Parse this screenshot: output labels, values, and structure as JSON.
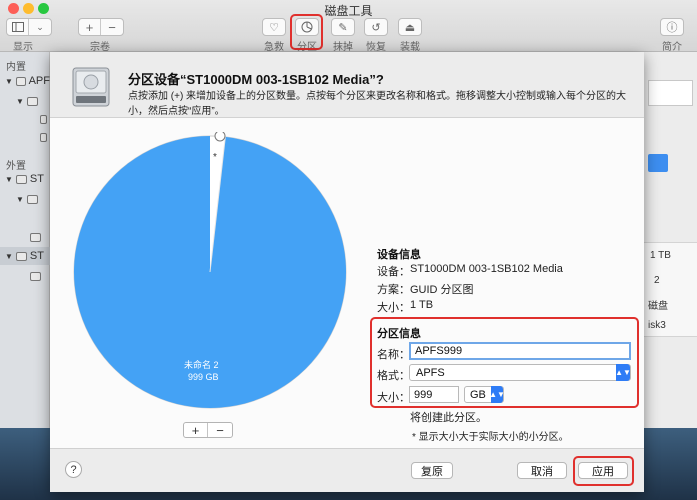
{
  "window": {
    "title": "磁盘工具",
    "toolbar": {
      "show_label": "显示",
      "volume_label": "宗卷",
      "firstaid_label": "急救",
      "partition_label": "分区",
      "erase_label": "抹掉",
      "restore_label": "恢复",
      "mount_label": "装载",
      "info_label": "简介",
      "add_glyph": "+",
      "remove_glyph": "−"
    }
  },
  "sidebar": {
    "internal_header": "内置",
    "external_header": "外置",
    "items": [
      {
        "label": "APF"
      },
      {
        "label": "ST"
      },
      {
        "label": "ST"
      }
    ]
  },
  "right_panel": {
    "cells": [
      "1 TB",
      "2",
      "磁盘",
      "isk3"
    ]
  },
  "sheet": {
    "title": "分区设备“ST1000DM 003-1SB102 Media”?",
    "description": "点按添加 (+) 来增加设备上的分区数量。点按每个分区来更改名称和格式。拖移调整大小控制或输入每个分区的大小，然后点按“应用”。",
    "pie": {
      "segment_label": "未命名 2",
      "segment_size": "999 GB",
      "small_mark": "*",
      "fraction": 0.999
    },
    "stepper": {
      "add": "+",
      "remove": "−"
    },
    "device_info": {
      "heading": "设备信息",
      "device_label": "设备：",
      "device_value": "ST1000DM 003-1SB102 Media",
      "scheme_label": "方案：",
      "scheme_value": "GUID 分区图",
      "size_label": "大小：",
      "size_value": "1 TB"
    },
    "partition_info": {
      "heading": "分区信息",
      "name_label": "名称：",
      "name_value": "APFS999",
      "format_label": "格式：",
      "format_value": "APFS",
      "size_label": "大小：",
      "size_value": "999",
      "unit_value": "GB",
      "note": "将创建此分区。"
    },
    "footnote": "* 显示大小大于实际大小的小分区。",
    "buttons": {
      "help": "?",
      "revert": "复原",
      "cancel": "取消",
      "apply": "应用"
    }
  },
  "colors": {
    "accent": "#2e7cf6",
    "pie_fill": "#44a2f5",
    "highlight": "#e0302d"
  }
}
